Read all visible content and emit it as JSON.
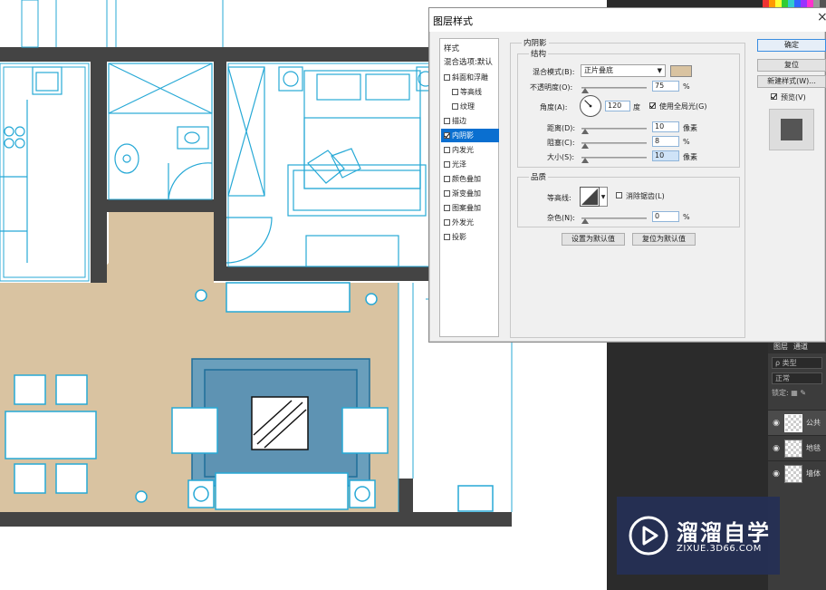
{
  "dialog": {
    "title": "图层样式",
    "close_glyph": "×",
    "styles_list": [
      {
        "label": "样式",
        "type": "header"
      },
      {
        "label": "混合选项:默认",
        "type": "header"
      },
      {
        "label": "斜面和浮雕",
        "checked": false
      },
      {
        "label": "等高线",
        "checked": false,
        "sub": true
      },
      {
        "label": "纹理",
        "checked": false,
        "sub": true
      },
      {
        "label": "描边",
        "checked": false
      },
      {
        "label": "内阴影",
        "checked": true,
        "selected": true
      },
      {
        "label": "内发光",
        "checked": false
      },
      {
        "label": "光泽",
        "checked": false
      },
      {
        "label": "颜色叠加",
        "checked": false
      },
      {
        "label": "渐变叠加",
        "checked": false
      },
      {
        "label": "图案叠加",
        "checked": false
      },
      {
        "label": "外发光",
        "checked": false
      },
      {
        "label": "投影",
        "checked": false
      }
    ],
    "inner_shadow": {
      "section_title": "内阴影",
      "structure_title": "结构",
      "blend_mode_label": "混合模式(B):",
      "blend_mode_value": "正片叠底",
      "shadow_color": "#d9c3a1",
      "opacity_label": "不透明度(O):",
      "opacity_value": "75",
      "opacity_unit": "%",
      "angle_label": "角度(A):",
      "angle_value": "120",
      "angle_unit": "度",
      "global_light_label": "使用全局光(G)",
      "global_light_checked": true,
      "distance_label": "距离(D):",
      "distance_value": "10",
      "distance_unit": "像素",
      "choke_label": "阻塞(C):",
      "choke_value": "8",
      "choke_unit": "%",
      "size_label": "大小(S):",
      "size_value": "10",
      "size_unit": "像素",
      "quality_title": "品质",
      "contour_label": "等高线:",
      "anti_alias_label": "消除锯齿(L)",
      "anti_alias_checked": false,
      "noise_label": "杂色(N):",
      "noise_value": "0",
      "noise_unit": "%",
      "make_default_label": "设置为默认值",
      "reset_default_label": "复位为默认值"
    },
    "buttons": {
      "ok": "确定",
      "reset": "复位",
      "new_style": "新建样式(W)...",
      "preview_label": "预览(V)",
      "preview_checked": true
    }
  },
  "layers_panel": {
    "tabs": [
      "图层",
      "通道"
    ],
    "filter_label": "ρ 类型",
    "blend_mode": "正常",
    "lock_label": "锁定:",
    "layers": [
      {
        "name": "公共",
        "selected": true
      },
      {
        "name": "地毯",
        "selected": false
      },
      {
        "name": "墙体",
        "selected": false
      }
    ]
  },
  "watermark": {
    "title": "溜溜自学",
    "url": "ZIXUE.3D66.COM"
  },
  "colors": {
    "plan_floor": "#d9c3a1",
    "plan_wall": "#444444",
    "plan_line": "#27a9d6",
    "ps_dark": "#2b2b2b",
    "selection_blue": "#0a6fd0"
  }
}
